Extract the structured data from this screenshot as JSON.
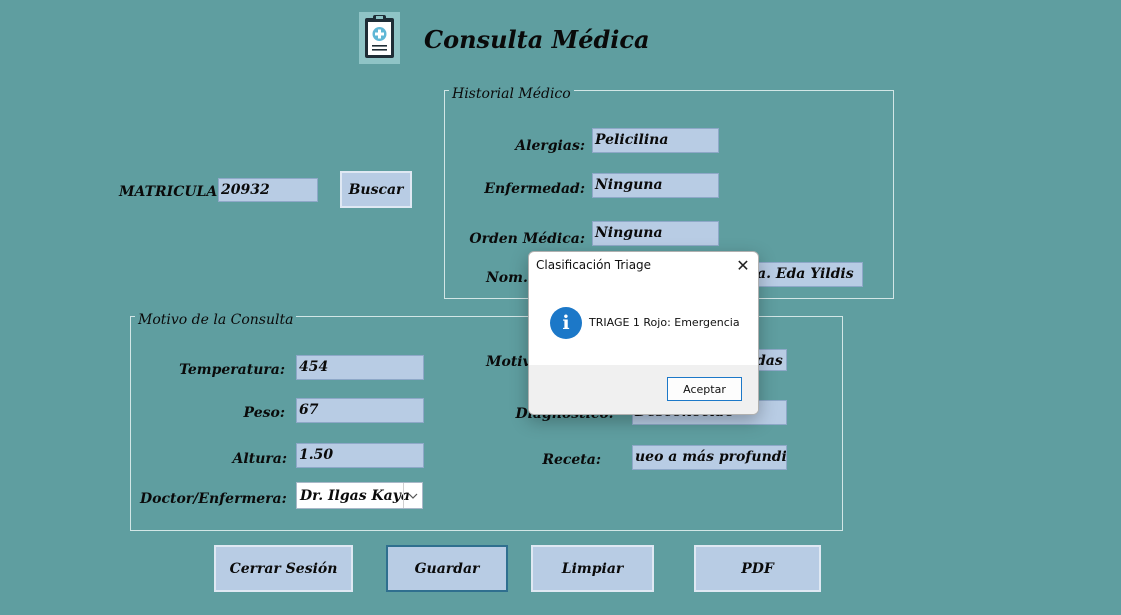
{
  "app": {
    "title": "Consulta Médica",
    "logo_icon": "clipboard-medical-icon"
  },
  "colors": {
    "background": "#5f9ea0",
    "field": "#b8cce4",
    "dialog_icon": "#1c78c8"
  },
  "search": {
    "matricula_label": "MATRICULA",
    "matricula_value": "20932",
    "buscar_label": "Buscar"
  },
  "historial": {
    "legend": "Historial Médico",
    "alergias_label": "Alergias:",
    "alergias_value": "Pelicilina",
    "enfermedad_label": "Enfermedad:",
    "enfermedad_value": "Ninguna",
    "orden_label": "Orden Médica:",
    "orden_value": "Ninguna",
    "nom_label": "Nom. d",
    "nom_value": "a. Eda Yildis"
  },
  "consulta": {
    "legend": "Motivo de la Consulta",
    "temperatura_label": "Temperatura:",
    "temperatura_value": "454",
    "peso_label": "Peso:",
    "peso_value": "67",
    "altura_label": "Altura:",
    "altura_value": "1.50",
    "doctor_label": "Doctor/Enfermera:",
    "doctor_value": "Dr. Ilgas Kaya",
    "motivo_label": "Motivo",
    "motivo_value": "das l",
    "diagnostico_label": "Diagnóstico:",
    "diagnostico_value": "Desconocido",
    "receta_label": "Receta:",
    "receta_value": "ueo a más profundidad"
  },
  "actions": {
    "cerrar": "Cerrar Sesión",
    "guardar": "Guardar",
    "limpiar": "Limpiar",
    "pdf": "PDF"
  },
  "dialog": {
    "title": "Clasificación Triage",
    "close_glyph": "✕",
    "icon_glyph": "i",
    "message": "TRIAGE 1 Rojo: Emergencia",
    "ok_label": "Aceptar"
  }
}
